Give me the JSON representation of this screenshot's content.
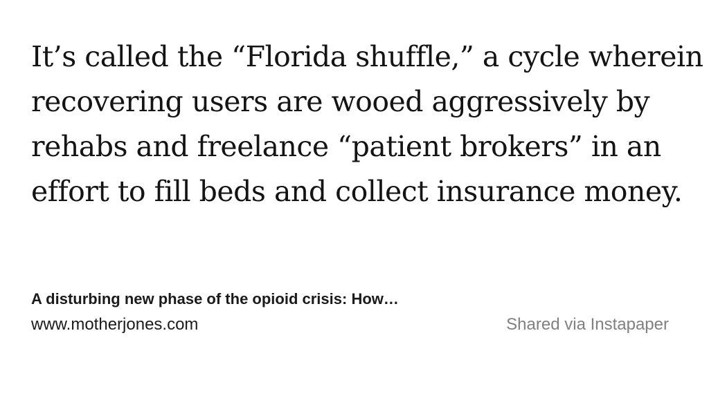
{
  "quote": {
    "lines": [
      "It’s called the “Florida shuffle,” a cycle wherein",
      "recovering users are wooed aggressively by",
      "rehabs and freelance “patient brokers” in an",
      "effort to fill beds and collect insurance money."
    ]
  },
  "article": {
    "title": "A disturbing new phase of the opioid crisis: How…",
    "domain": "www.motherjones.com"
  },
  "footer": {
    "shared_via": "Shared via Instapaper"
  },
  "colors": {
    "text": "#141414",
    "muted": "#808080",
    "background": "#ffffff"
  }
}
